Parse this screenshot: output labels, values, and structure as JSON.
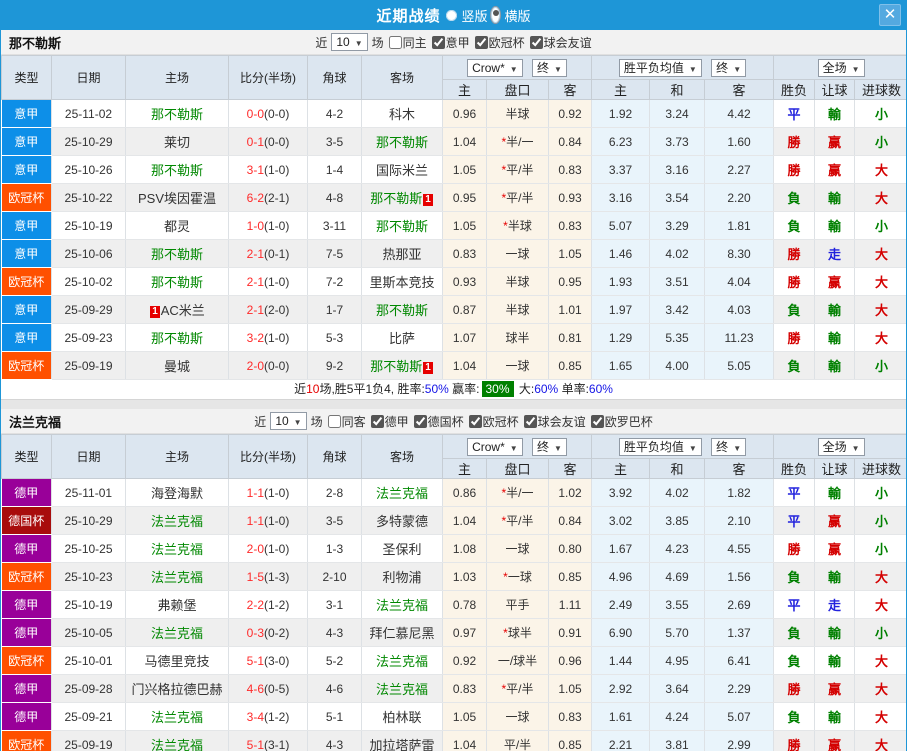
{
  "titlebar": {
    "title": "近期战绩",
    "layout_options": [
      {
        "label": "竖版",
        "selected": false
      },
      {
        "label": "横版",
        "selected": true
      }
    ],
    "close": "✕"
  },
  "colors": {
    "titlebar_blue": "#1E96D7",
    "focal_team_green": "#008800",
    "score_red": "#FF2A2A",
    "win_red": "#D40000",
    "lose_green": "#008000",
    "draw_blue": "#2222DD",
    "rate_badge_green": "#008000"
  },
  "league_colors": {
    "意甲": "#0D8FE8",
    "欧冠杯": "#FF5000",
    "德甲": "#990099",
    "德国杯": "#A80C0C"
  },
  "columns": {
    "type": "类型",
    "date": "日期",
    "home": "主场",
    "score": "比分(半场)",
    "corner": "角球",
    "away": "客场",
    "ah_home": "主",
    "handicap": "盘口",
    "ah_away": "客",
    "eu_home": "主",
    "eu_draw": "和",
    "eu_away": "客",
    "result": "胜负",
    "ah_result": "让球",
    "goals": "进球数"
  },
  "tables": [
    {
      "team": "那不勒斯",
      "filters": {
        "prefix": "近",
        "count": "10",
        "suffix": "场",
        "same_label": "同主",
        "same_checked": false,
        "leagues": [
          {
            "label": "意甲",
            "checked": true
          },
          {
            "label": "欧冠杯",
            "checked": true
          },
          {
            "label": "球会友谊",
            "checked": true
          }
        ]
      },
      "selects": {
        "bookmaker": "Crow*",
        "stage1": "终",
        "avg": "胜平负均值",
        "stage2": "终",
        "scope": "全场"
      },
      "rows": [
        {
          "lg": "意甲",
          "date": "25-11-02",
          "home": {
            "n": "那不勒斯",
            "g": 1
          },
          "ft": "0-0",
          "ht": "(0-0)",
          "ck": "4-2",
          "away": {
            "n": "科木"
          },
          "ah": [
            "0.96",
            "半球",
            "0.92"
          ],
          "eu": [
            "1.92",
            "3.24",
            "4.42"
          ],
          "res": [
            [
              "平",
              "b"
            ],
            [
              "輸",
              "g"
            ],
            [
              "小",
              "g"
            ]
          ]
        },
        {
          "lg": "意甲",
          "date": "25-10-29",
          "home": {
            "n": "莱切"
          },
          "ft": "0-1",
          "ht": "(0-0)",
          "ck": "3-5",
          "away": {
            "n": "那不勒斯",
            "g": 1
          },
          "ah": [
            "1.04",
            "*半/一",
            "0.84"
          ],
          "eu": [
            "6.23",
            "3.73",
            "1.60"
          ],
          "res": [
            [
              "勝",
              "r"
            ],
            [
              "赢",
              "r"
            ],
            [
              "小",
              "g"
            ]
          ]
        },
        {
          "lg": "意甲",
          "date": "25-10-26",
          "home": {
            "n": "那不勒斯",
            "g": 1
          },
          "ft": "3-1",
          "ht": "(1-0)",
          "ck": "1-4",
          "away": {
            "n": "国际米兰"
          },
          "ah": [
            "1.05",
            "*平/半",
            "0.83"
          ],
          "eu": [
            "3.37",
            "3.16",
            "2.27"
          ],
          "res": [
            [
              "勝",
              "r"
            ],
            [
              "赢",
              "r"
            ],
            [
              "大",
              "r"
            ]
          ]
        },
        {
          "lg": "欧冠杯",
          "date": "25-10-22",
          "home": {
            "n": "PSV埃因霍温"
          },
          "ft": "6-2",
          "ht": "(2-1)",
          "ck": "4-8",
          "away": {
            "n": "那不勒斯",
            "g": 1,
            "card": "1",
            "cardpos": "after"
          },
          "ah": [
            "0.95",
            "*平/半",
            "0.93"
          ],
          "eu": [
            "3.16",
            "3.54",
            "2.20"
          ],
          "res": [
            [
              "負",
              "g"
            ],
            [
              "輸",
              "g"
            ],
            [
              "大",
              "r"
            ]
          ]
        },
        {
          "lg": "意甲",
          "date": "25-10-19",
          "home": {
            "n": "都灵"
          },
          "ft": "1-0",
          "ht": "(1-0)",
          "ck": "3-11",
          "away": {
            "n": "那不勒斯",
            "g": 1
          },
          "ah": [
            "1.05",
            "*半球",
            "0.83"
          ],
          "eu": [
            "5.07",
            "3.29",
            "1.81"
          ],
          "res": [
            [
              "負",
              "g"
            ],
            [
              "輸",
              "g"
            ],
            [
              "小",
              "g"
            ]
          ]
        },
        {
          "lg": "意甲",
          "date": "25-10-06",
          "home": {
            "n": "那不勒斯",
            "g": 1
          },
          "ft": "2-1",
          "ht": "(0-1)",
          "ck": "7-5",
          "away": {
            "n": "热那亚"
          },
          "ah": [
            "0.83",
            "一球",
            "1.05"
          ],
          "eu": [
            "1.46",
            "4.02",
            "8.30"
          ],
          "res": [
            [
              "勝",
              "r"
            ],
            [
              "走",
              "b"
            ],
            [
              "大",
              "r"
            ]
          ]
        },
        {
          "lg": "欧冠杯",
          "date": "25-10-02",
          "home": {
            "n": "那不勒斯",
            "g": 1
          },
          "ft": "2-1",
          "ht": "(1-0)",
          "ck": "7-2",
          "away": {
            "n": "里斯本竞技"
          },
          "ah": [
            "0.93",
            "半球",
            "0.95"
          ],
          "eu": [
            "1.93",
            "3.51",
            "4.04"
          ],
          "res": [
            [
              "勝",
              "r"
            ],
            [
              "赢",
              "r"
            ],
            [
              "大",
              "r"
            ]
          ]
        },
        {
          "lg": "意甲",
          "date": "25-09-29",
          "home": {
            "n": "AC米兰",
            "card": "1",
            "cardpos": "before"
          },
          "ft": "2-1",
          "ht": "(2-0)",
          "ck": "1-7",
          "away": {
            "n": "那不勒斯",
            "g": 1
          },
          "ah": [
            "0.87",
            "半球",
            "1.01"
          ],
          "eu": [
            "1.97",
            "3.42",
            "4.03"
          ],
          "res": [
            [
              "負",
              "g"
            ],
            [
              "輸",
              "g"
            ],
            [
              "大",
              "r"
            ]
          ]
        },
        {
          "lg": "意甲",
          "date": "25-09-23",
          "home": {
            "n": "那不勒斯",
            "g": 1
          },
          "ft": "3-2",
          "ht": "(1-0)",
          "ck": "5-3",
          "away": {
            "n": "比萨"
          },
          "ah": [
            "1.07",
            "球半",
            "0.81"
          ],
          "eu": [
            "1.29",
            "5.35",
            "11.23"
          ],
          "res": [
            [
              "勝",
              "r"
            ],
            [
              "輸",
              "g"
            ],
            [
              "大",
              "r"
            ]
          ]
        },
        {
          "lg": "欧冠杯",
          "date": "25-09-19",
          "home": {
            "n": "曼城"
          },
          "ft": "2-0",
          "ht": "(0-0)",
          "ck": "9-2",
          "away": {
            "n": "那不勒斯",
            "g": 1,
            "card": "1",
            "cardpos": "after"
          },
          "ah": [
            "1.04",
            "一球",
            "0.85"
          ],
          "eu": [
            "1.65",
            "4.00",
            "5.05"
          ],
          "res": [
            [
              "負",
              "g"
            ],
            [
              "輸",
              "g"
            ],
            [
              "小",
              "g"
            ]
          ]
        }
      ],
      "summary": [
        {
          "t": "近",
          "c": ""
        },
        {
          "t": "10",
          "c": "red"
        },
        {
          "t": "场,胜5平1负4, 胜率:",
          "c": ""
        },
        {
          "t": "50%",
          "c": "blue"
        },
        {
          "t": " 赢率:",
          "c": ""
        },
        {
          "t": "30%",
          "c": "pct-badge"
        },
        {
          "t": " 大:",
          "c": ""
        },
        {
          "t": "60%",
          "c": "blue"
        },
        {
          "t": " 单率:",
          "c": ""
        },
        {
          "t": "60%",
          "c": "blue"
        }
      ]
    },
    {
      "team": "法兰克福",
      "filters": {
        "prefix": "近",
        "count": "10",
        "suffix": "场",
        "same_label": "同客",
        "same_checked": false,
        "leagues": [
          {
            "label": "德甲",
            "checked": true
          },
          {
            "label": "德国杯",
            "checked": true
          },
          {
            "label": "欧冠杯",
            "checked": true
          },
          {
            "label": "球会友谊",
            "checked": true
          },
          {
            "label": "欧罗巴杯",
            "checked": true
          }
        ]
      },
      "selects": {
        "bookmaker": "Crow*",
        "stage1": "终",
        "avg": "胜平负均值",
        "stage2": "终",
        "scope": "全场"
      },
      "rows": [
        {
          "lg": "德甲",
          "date": "25-11-01",
          "home": {
            "n": "海登海默"
          },
          "ft": "1-1",
          "ht": "(1-0)",
          "ck": "2-8",
          "away": {
            "n": "法兰克福",
            "g": 1
          },
          "ah": [
            "0.86",
            "*半/一",
            "1.02"
          ],
          "eu": [
            "3.92",
            "4.02",
            "1.82"
          ],
          "res": [
            [
              "平",
              "b"
            ],
            [
              "輸",
              "g"
            ],
            [
              "小",
              "g"
            ]
          ]
        },
        {
          "lg": "德国杯",
          "date": "25-10-29",
          "home": {
            "n": "法兰克福",
            "g": 1
          },
          "ft": "1-1",
          "ht": "(1-0)",
          "ck": "3-5",
          "away": {
            "n": "多特蒙德"
          },
          "ah": [
            "1.04",
            "*平/半",
            "0.84"
          ],
          "eu": [
            "3.02",
            "3.85",
            "2.10"
          ],
          "res": [
            [
              "平",
              "b"
            ],
            [
              "赢",
              "r"
            ],
            [
              "小",
              "g"
            ]
          ]
        },
        {
          "lg": "德甲",
          "date": "25-10-25",
          "home": {
            "n": "法兰克福",
            "g": 1
          },
          "ft": "2-0",
          "ht": "(1-0)",
          "ck": "1-3",
          "away": {
            "n": "圣保利"
          },
          "ah": [
            "1.08",
            "一球",
            "0.80"
          ],
          "eu": [
            "1.67",
            "4.23",
            "4.55"
          ],
          "res": [
            [
              "勝",
              "r"
            ],
            [
              "赢",
              "r"
            ],
            [
              "小",
              "g"
            ]
          ]
        },
        {
          "lg": "欧冠杯",
          "date": "25-10-23",
          "home": {
            "n": "法兰克福",
            "g": 1
          },
          "ft": "1-5",
          "ht": "(1-3)",
          "ck": "2-10",
          "away": {
            "n": "利物浦"
          },
          "ah": [
            "1.03",
            "*一球",
            "0.85"
          ],
          "eu": [
            "4.96",
            "4.69",
            "1.56"
          ],
          "res": [
            [
              "負",
              "g"
            ],
            [
              "輸",
              "g"
            ],
            [
              "大",
              "r"
            ]
          ]
        },
        {
          "lg": "德甲",
          "date": "25-10-19",
          "home": {
            "n": "弗赖堡"
          },
          "ft": "2-2",
          "ht": "(1-2)",
          "ck": "3-1",
          "away": {
            "n": "法兰克福",
            "g": 1
          },
          "ah": [
            "0.78",
            "平手",
            "1.11"
          ],
          "eu": [
            "2.49",
            "3.55",
            "2.69"
          ],
          "res": [
            [
              "平",
              "b"
            ],
            [
              "走",
              "b"
            ],
            [
              "大",
              "r"
            ]
          ]
        },
        {
          "lg": "德甲",
          "date": "25-10-05",
          "home": {
            "n": "法兰克福",
            "g": 1
          },
          "ft": "0-3",
          "ht": "(0-2)",
          "ck": "4-3",
          "away": {
            "n": "拜仁慕尼黑"
          },
          "ah": [
            "0.97",
            "*球半",
            "0.91"
          ],
          "eu": [
            "6.90",
            "5.70",
            "1.37"
          ],
          "res": [
            [
              "負",
              "g"
            ],
            [
              "輸",
              "g"
            ],
            [
              "小",
              "g"
            ]
          ]
        },
        {
          "lg": "欧冠杯",
          "date": "25-10-01",
          "home": {
            "n": "马德里竞技"
          },
          "ft": "5-1",
          "ht": "(3-0)",
          "ck": "5-2",
          "away": {
            "n": "法兰克福",
            "g": 1
          },
          "ah": [
            "0.92",
            "一/球半",
            "0.96"
          ],
          "eu": [
            "1.44",
            "4.95",
            "6.41"
          ],
          "res": [
            [
              "負",
              "g"
            ],
            [
              "輸",
              "g"
            ],
            [
              "大",
              "r"
            ]
          ]
        },
        {
          "lg": "德甲",
          "date": "25-09-28",
          "home": {
            "n": "门兴格拉德巴赫"
          },
          "ft": "4-6",
          "ht": "(0-5)",
          "ck": "4-6",
          "away": {
            "n": "法兰克福",
            "g": 1
          },
          "ah": [
            "0.83",
            "*平/半",
            "1.05"
          ],
          "eu": [
            "2.92",
            "3.64",
            "2.29"
          ],
          "res": [
            [
              "勝",
              "r"
            ],
            [
              "赢",
              "r"
            ],
            [
              "大",
              "r"
            ]
          ]
        },
        {
          "lg": "德甲",
          "date": "25-09-21",
          "home": {
            "n": "法兰克福",
            "g": 1
          },
          "ft": "3-4",
          "ht": "(1-2)",
          "ck": "5-1",
          "away": {
            "n": "柏林联"
          },
          "ah": [
            "1.05",
            "一球",
            "0.83"
          ],
          "eu": [
            "1.61",
            "4.24",
            "5.07"
          ],
          "res": [
            [
              "負",
              "g"
            ],
            [
              "輸",
              "g"
            ],
            [
              "大",
              "r"
            ]
          ]
        },
        {
          "lg": "欧冠杯",
          "date": "25-09-19",
          "home": {
            "n": "法兰克福",
            "g": 1
          },
          "ft": "5-1",
          "ht": "(3-1)",
          "ck": "4-3",
          "away": {
            "n": "加拉塔萨雷"
          },
          "ah": [
            "1.04",
            "平/半",
            "0.85"
          ],
          "eu": [
            "2.21",
            "3.81",
            "2.99"
          ],
          "res": [
            [
              "勝",
              "r"
            ],
            [
              "赢",
              "r"
            ],
            [
              "大",
              "r"
            ]
          ]
        }
      ],
      "summary": []
    }
  ]
}
